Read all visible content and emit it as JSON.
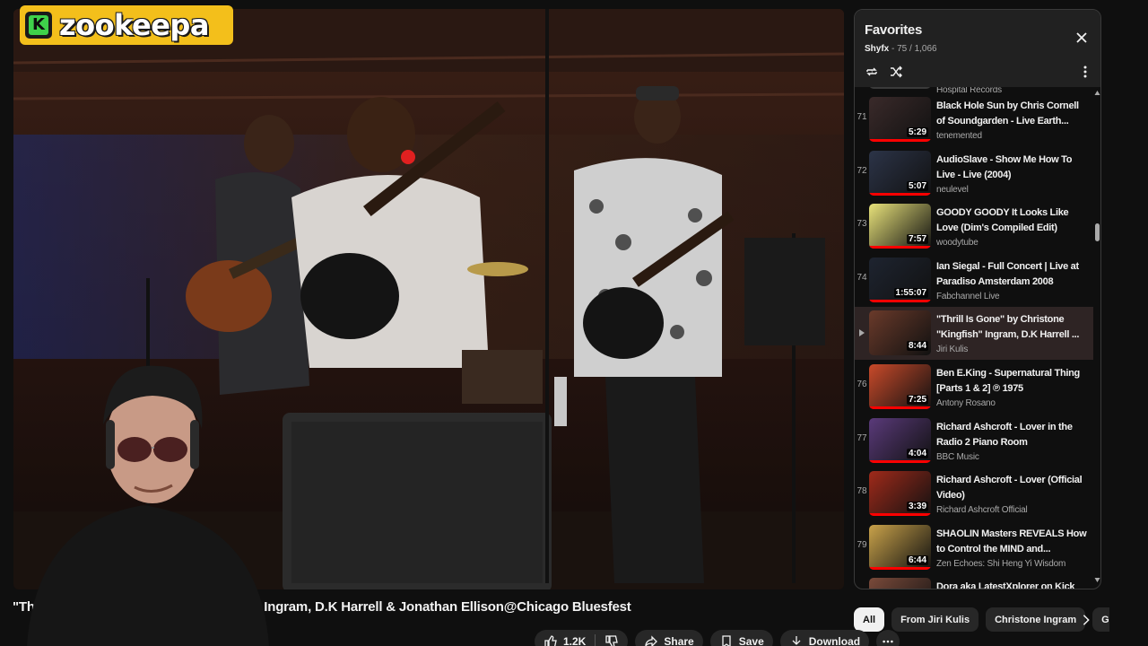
{
  "brand": {
    "logo_letter": "K",
    "name": "zookeepa"
  },
  "video": {
    "title": "\"Thrill Is Gone\" by Christone \"Kingfish\" Ingram, D.K Harrell & Jonathan Ellison@Chicago Bluesfest",
    "likes": "1.2K",
    "share_label": "Share",
    "save_label": "Save",
    "download_label": "Download"
  },
  "playlist": {
    "title": "Favorites",
    "owner": "Shyfx",
    "position": "75 / 1,066",
    "partial_top_channel": "Hospital Records",
    "partial_bottom_title": "Dora aka LatestXplorer on Kick",
    "items": [
      {
        "index": "71",
        "title": "Black Hole Sun by Chris Cornell of Soundgarden - Live Earth...",
        "channel": "tenemented",
        "duration": "5:29",
        "progress": 1.0,
        "thumb_color": "#3a2a2a"
      },
      {
        "index": "72",
        "title": "AudioSlave - Show Me How To Live - Live (2004)",
        "channel": "neulevel",
        "duration": "5:07",
        "progress": 1.0,
        "thumb_color": "#2c3448"
      },
      {
        "index": "73",
        "title": "GOODY GOODY It Looks Like Love (Dim's Compiled Edit)",
        "channel": "woodytube",
        "duration": "7:57",
        "progress": 1.0,
        "thumb_color": "#e8e27a"
      },
      {
        "index": "74",
        "title": "Ian Siegal - Full Concert | Live at Paradiso Amsterdam 2008",
        "channel": "Fabchannel Live",
        "duration": "1:55:07",
        "progress": 1.0,
        "thumb_color": "#1e2430"
      },
      {
        "index": "75",
        "title": "\"Thrill Is Gone\" by Christone \"Kingfish\" Ingram, D.K Harrell ...",
        "channel": "Jiri Kulis",
        "duration": "8:44",
        "progress": 0.0,
        "thumb_color": "#6a3a2a"
      },
      {
        "index": "76",
        "title": "Ben E.King - Supernatural Thing [Parts 1 & 2] ℗ 1975",
        "channel": "Antony Rosano",
        "duration": "7:25",
        "progress": 1.0,
        "thumb_color": "#c94a2a"
      },
      {
        "index": "77",
        "title": "Richard Ashcroft - Lover in the Radio 2 Piano Room",
        "channel": "BBC Music",
        "duration": "4:04",
        "progress": 1.0,
        "thumb_color": "#5a3a7a"
      },
      {
        "index": "78",
        "title": "Richard Ashcroft - Lover (Official Video)",
        "channel": "Richard Ashcroft Official",
        "duration": "3:39",
        "progress": 1.0,
        "thumb_color": "#a02a1a"
      },
      {
        "index": "79",
        "title": "SHAOLIN Masters REVEALS How to Control the MIND and...",
        "channel": "Zen Echoes: Shi Heng Yi Wisdom",
        "duration": "6:44",
        "progress": 1.0,
        "thumb_color": "#c9a24a"
      }
    ]
  },
  "chips": [
    "All",
    "From Jiri Kulis",
    "Christone Ingram",
    "Guitar"
  ]
}
